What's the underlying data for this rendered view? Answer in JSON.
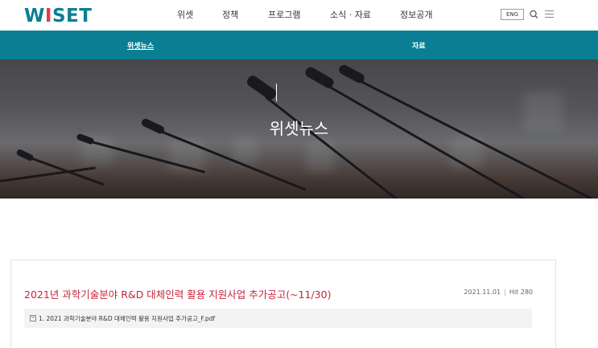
{
  "header": {
    "logo": "WISET",
    "nav": [
      "위셋",
      "정책",
      "프로그램",
      "소식 · 자료",
      "정보공개"
    ],
    "eng_label": "ENG"
  },
  "subnav": {
    "items": [
      "위셋뉴스",
      "자료"
    ]
  },
  "hero": {
    "title": "위셋뉴스"
  },
  "article": {
    "title": "2021년 과학기술분야 R&D 대체인력 활용 지원사업 추가공고(~11/30)",
    "date": "2021.11.01",
    "hit": "Hit 280",
    "attachment": "1. 2021 과학기술분야 R&D 대체인력 활용 지원사업 추가공고_F.pdf"
  },
  "colors": {
    "brand": "#0a7f93",
    "accent": "#e33b4e",
    "title_red": "#c8243a"
  }
}
